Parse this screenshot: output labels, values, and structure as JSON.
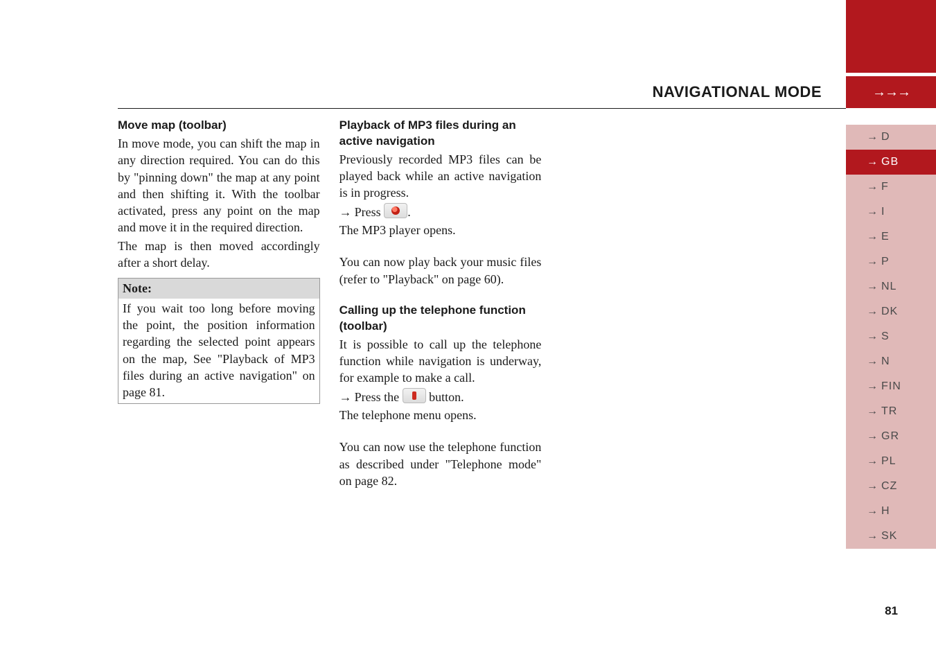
{
  "header": {
    "title": "NAVIGATIONAL MODE"
  },
  "column1": {
    "heading": "Move map (toolbar)",
    "p1": "In move mode, you can shift the map in any direction required. You can do this by \"pinning down\" the map at any point and then shifting it. With the toolbar activated, press any point on the map and move it in the required direction.",
    "p2": "The map is then moved accordingly after a short delay.",
    "note_label": "Note:",
    "note_body": "If you wait too long before moving the point, the position information regarding the selected point appears on the map, See \"Playback of MP3 files during an active navigation\" on page 81."
  },
  "column2": {
    "sec1_heading": "Playback of MP3 files during an active navigation",
    "sec1_p1": "Previously recorded MP3 files can be played back while an active navigation is in progress.",
    "sec1_press": "Press",
    "sec1_end": ".",
    "sec1_p2": "The MP3 player opens.",
    "sec1_p3": "You can now play back your music files (refer to \"Playback\" on page 60).",
    "sec2_heading": "Calling up the telephone function (toolbar)",
    "sec2_p1": "It is possible to call up the telephone function while navigation is underway, for example to make a call.",
    "sec2_press_the": "Press the",
    "sec2_button_suffix": "button.",
    "sec2_p2": "The telephone menu opens.",
    "sec2_p3": "You can now use the telephone function as described under \"Telephone mode\" on page 82."
  },
  "sidebar_items": [
    {
      "label": "D",
      "variant": "light"
    },
    {
      "label": "GB",
      "variant": "dark"
    },
    {
      "label": "F",
      "variant": "light"
    },
    {
      "label": "I",
      "variant": "light"
    },
    {
      "label": "E",
      "variant": "light"
    },
    {
      "label": "P",
      "variant": "light"
    },
    {
      "label": "NL",
      "variant": "light"
    },
    {
      "label": "DK",
      "variant": "light"
    },
    {
      "label": "S",
      "variant": "light"
    },
    {
      "label": "N",
      "variant": "light"
    },
    {
      "label": "FIN",
      "variant": "light"
    },
    {
      "label": "TR",
      "variant": "light"
    },
    {
      "label": "GR",
      "variant": "light"
    },
    {
      "label": "PL",
      "variant": "light"
    },
    {
      "label": "CZ",
      "variant": "light"
    },
    {
      "label": "H",
      "variant": "light"
    },
    {
      "label": "SK",
      "variant": "light"
    }
  ],
  "page_number": "81",
  "icons": {
    "mp3": "disc-icon",
    "phone": "phone-icon"
  }
}
